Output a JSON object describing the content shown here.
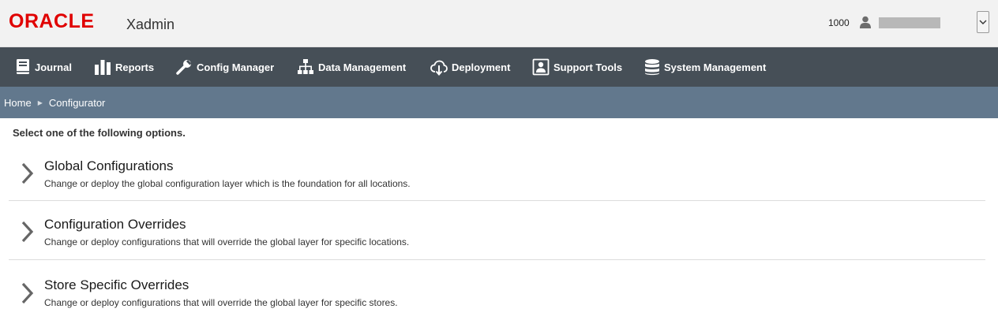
{
  "header": {
    "logo_text": "ORACLE",
    "app_name": "Xadmin",
    "store_number": "1000",
    "brand_color": "#e00000"
  },
  "nav": {
    "items": [
      {
        "label": "Journal",
        "icon": "journal-icon"
      },
      {
        "label": "Reports",
        "icon": "reports-icon"
      },
      {
        "label": "Config Manager",
        "icon": "wrench-icon"
      },
      {
        "label": "Data Management",
        "icon": "hierarchy-icon"
      },
      {
        "label": "Deployment",
        "icon": "cloud-download-icon"
      },
      {
        "label": "Support Tools",
        "icon": "support-icon"
      },
      {
        "label": "System Management",
        "icon": "database-icon"
      }
    ]
  },
  "breadcrumb": {
    "home": "Home",
    "current": "Configurator"
  },
  "main": {
    "instructions": "Select one of the following options.",
    "options": [
      {
        "title": "Global Configurations",
        "description": "Change or deploy the global configuration layer which is the foundation for all locations."
      },
      {
        "title": "Configuration Overrides",
        "description": "Change or deploy configurations that will override the global layer for specific locations."
      },
      {
        "title": "Store Specific Overrides",
        "description": "Change or deploy configurations that will override the global layer for specific stores."
      }
    ]
  }
}
